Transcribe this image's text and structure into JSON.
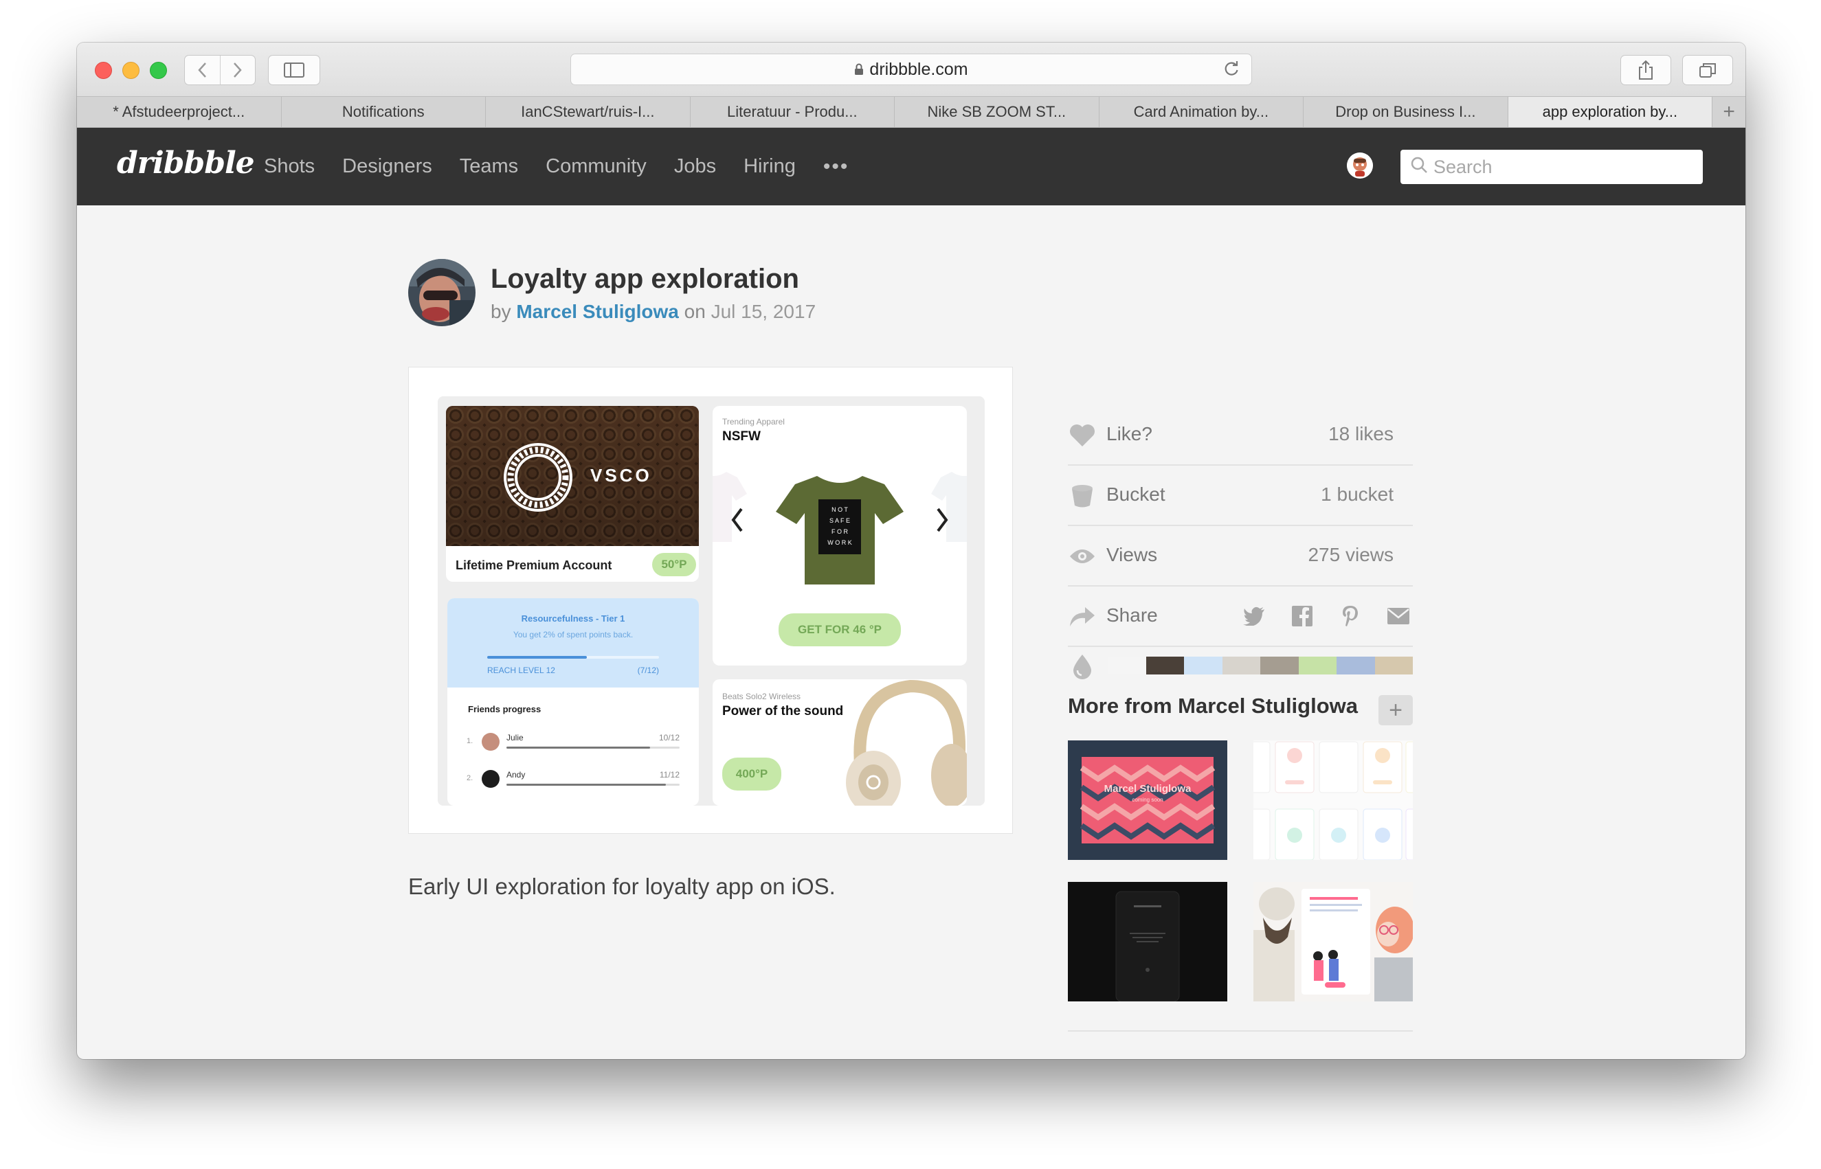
{
  "browser": {
    "url": "dribbble.com",
    "tabs": [
      {
        "label": "* Afstudeerproject..."
      },
      {
        "label": "Notifications"
      },
      {
        "label": "IanCStewart/ruis-I..."
      },
      {
        "label": "Literatuur - Produ..."
      },
      {
        "label": "Nike SB ZOOM ST..."
      },
      {
        "label": "Card Animation by..."
      },
      {
        "label": "Drop on Business I..."
      },
      {
        "label": "app exploration by..."
      }
    ],
    "new_tab_label": "+"
  },
  "header": {
    "logo": "dribbble",
    "nav": [
      "Shots",
      "Designers",
      "Teams",
      "Community",
      "Jobs",
      "Hiring"
    ],
    "more": "•••",
    "search_placeholder": "Search"
  },
  "shot": {
    "title": "Loyalty app exploration",
    "by": "by",
    "author": "Marcel Stuliglowa",
    "on": "on",
    "date": "Jul 15, 2017",
    "description": "Early UI exploration for loyalty app on iOS."
  },
  "mockup": {
    "vsco_brand": "VSCO",
    "vsco_label": "Lifetime Premium Account",
    "vsco_points": "50°P",
    "tier_title": "Resourcefulness - Tier 1",
    "tier_sub": "You get 2% of spent points back.",
    "tier_reach": "REACH LEVEL 12",
    "tier_count": "(7/12)",
    "tier_progress": 0.58,
    "friends_title": "Friends progress",
    "friends": [
      {
        "num": "1.",
        "name": "Julie",
        "score": "10/12",
        "progress": 0.83
      },
      {
        "num": "2.",
        "name": "Andy",
        "score": "11/12",
        "progress": 0.92
      }
    ],
    "nsfw_category": "Trending Apparel",
    "nsfw_title": "NSFW",
    "nsfw_shirt_text": [
      "N O T",
      "S A F E",
      "F O R",
      "W O R K"
    ],
    "nsfw_cta": "GET FOR 46 °P",
    "beats_category": "Beats Solo2 Wireless",
    "beats_title": "Power of the sound",
    "beats_points": "400°P"
  },
  "stats": {
    "like_label": "Like?",
    "like_value": "18 likes",
    "bucket_label": "Bucket",
    "bucket_value": "1 bucket",
    "views_label": "Views",
    "views_value": "275 views",
    "share_label": "Share"
  },
  "palette": [
    "#f5f5f5",
    "#4a4038",
    "#cfe3f7",
    "#d8d4cd",
    "#a59d91",
    "#c6e2a6",
    "#a9bcdc",
    "#d6c8ad"
  ],
  "more": {
    "title": "More from Marcel Stuliglowa",
    "add": "+",
    "thumb1_title": "Marcel Stuliglowa",
    "thumb1_sub": "coming soon"
  },
  "colors": {
    "header_bg": "#333333",
    "link": "#3a8bbb",
    "accent_green": "#c6e8a8"
  }
}
